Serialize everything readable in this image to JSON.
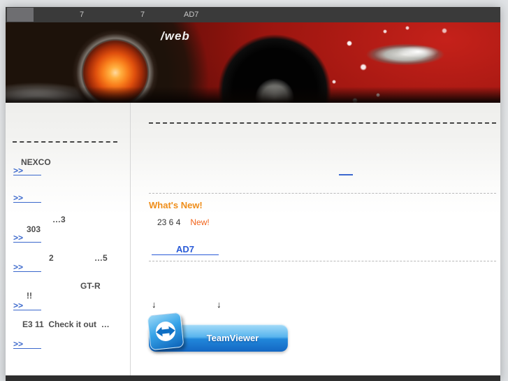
{
  "topbar": {
    "nav_items": [
      "7",
      "7",
      "AD7"
    ]
  },
  "header": {
    "wordmark": "/web"
  },
  "sidebar": {
    "heading": "NEXCO",
    "links": [
      ">>",
      ">>",
      ">>",
      ">>",
      ">>",
      ">>"
    ],
    "fragments": {
      "dots3": "…3",
      "n303": "303",
      "n2": "2",
      "dots5": "…5",
      "gtr": "GT-R",
      "bang": "!!",
      "e3": "E3 11  Check it out  …"
    }
  },
  "main": {
    "whats_new_title": "What's New!",
    "news_date": "23 6 4",
    "news_badge": "New!",
    "ad7_link": "AD7",
    "download_arrow": "↓",
    "teamviewer_label": "TeamViewer"
  },
  "colors": {
    "topbar_bg": "#3a3a3a",
    "footer_bg": "#2e2e2e",
    "accent_orange": "#ef8e1b",
    "badge_orange": "#f2641c",
    "link_blue": "#3b68cc",
    "ad7_blue": "#2a5bd7",
    "teamviewer_blue": "#1f86d9",
    "foglamp_orange": "#f97f1c"
  }
}
